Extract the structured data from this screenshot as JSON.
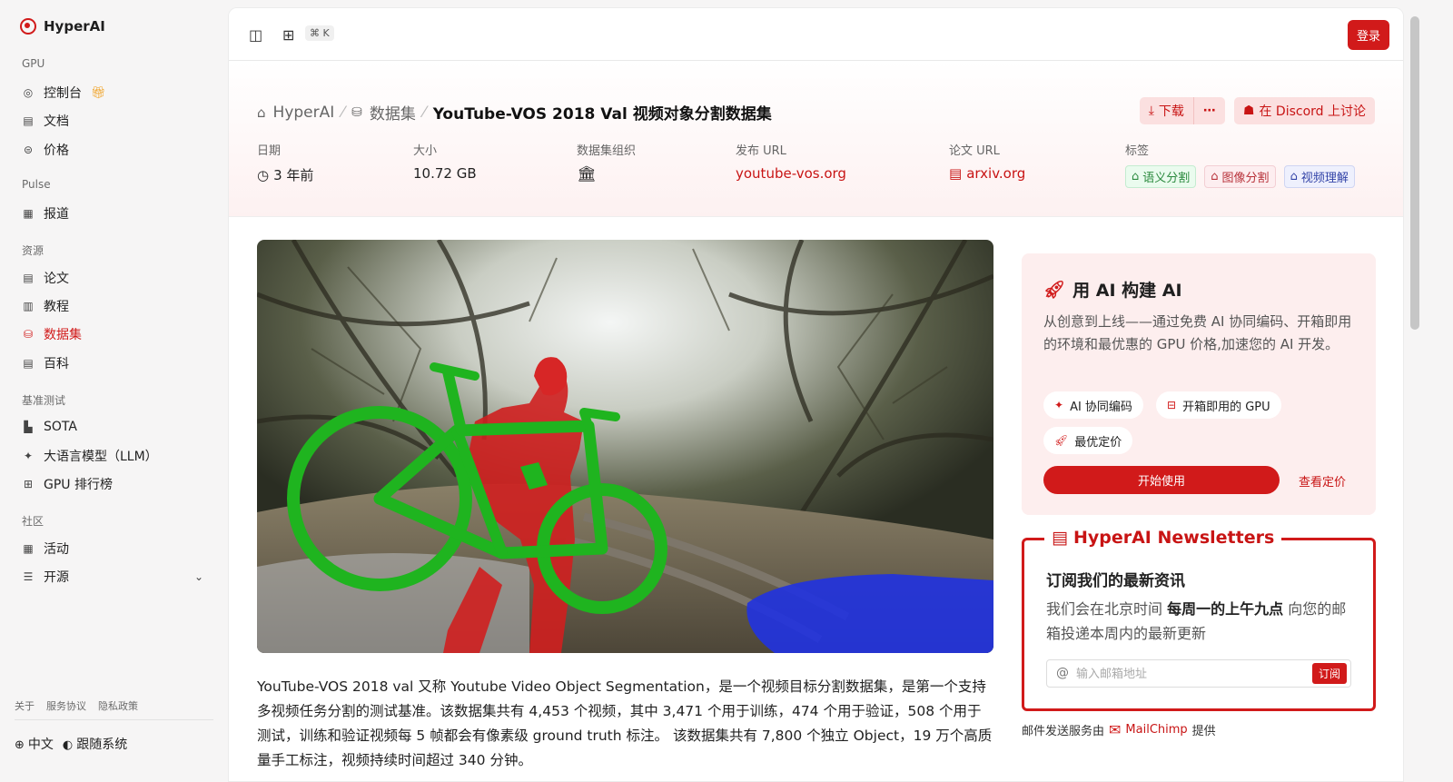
{
  "app": {
    "name": "HyperAI"
  },
  "sidebar": {
    "sections": [
      {
        "label": "GPU",
        "items": [
          {
            "label": "控制台",
            "icon": "dashboard-icon",
            "badge": "gift-icon"
          },
          {
            "label": "文档",
            "icon": "doc-icon"
          },
          {
            "label": "价格",
            "icon": "price-icon"
          }
        ]
      },
      {
        "label": "Pulse",
        "items": [
          {
            "label": "报道",
            "icon": "news-icon"
          }
        ]
      },
      {
        "label": "资源",
        "items": [
          {
            "label": "论文",
            "icon": "paper-icon"
          },
          {
            "label": "教程",
            "icon": "book-icon"
          },
          {
            "label": "数据集",
            "icon": "database-icon",
            "active": true
          },
          {
            "label": "百科",
            "icon": "wiki-icon"
          }
        ]
      },
      {
        "label": "基准测试",
        "items": [
          {
            "label": "SOTA",
            "icon": "chart-icon"
          },
          {
            "label": "大语言模型（LLM）",
            "icon": "sparkle-icon"
          },
          {
            "label": "GPU 排行榜",
            "icon": "chip-icon"
          }
        ]
      },
      {
        "label": "社区",
        "items": [
          {
            "label": "活动",
            "icon": "calendar-icon"
          },
          {
            "label": "开源",
            "icon": "menu-icon"
          }
        ]
      }
    ],
    "footer_links": [
      "关于",
      "服务协议",
      "隐私政策"
    ],
    "language": "中文",
    "theme": "跟随系统"
  },
  "topbar": {
    "shortcut": "⌘ K",
    "login_label": "登录"
  },
  "breadcrumb": {
    "home": "HyperAI",
    "section": "数据集",
    "current": "YouTube-VOS 2018 Val 视频对象分割数据集"
  },
  "actions": {
    "download": "下载",
    "more": "⋯",
    "discord": "在 Discord 上讨论"
  },
  "meta": {
    "date_label": "日期",
    "date_value": "3 年前",
    "size_label": "大小",
    "size_value": "10.72 GB",
    "org_label": "数据集组织",
    "url_label": "发布 URL",
    "url_value": "youtube-vos.org",
    "paper_label": "论文 URL",
    "paper_value": "arxiv.org",
    "tags_label": "标签",
    "tags": [
      "语义分割",
      "图像分割",
      "视频理解"
    ]
  },
  "description": "YouTube-VOS 2018 val 又称 Youtube Video Object Segmentation，是一个视频目标分割数据集，是第一个支持多视频任务分割的测试基准。该数据集共有 4,453 个视频，其中 3,471 个用于训练，474 个用于验证，508 个用于测试，训练和验证视频每 5 帧都会有像素级 ground truth 标注。 该数据集共有 7,800 个独立 Object，19 万个高质量手工标注，视频持续时间超过 340 分钟。",
  "ai_card": {
    "title": "用 AI 构建 AI",
    "text": "从创意到上线——通过免费 AI 协同编码、开箱即用的环境和最优惠的 GPU 价格,加速您的 AI 开发。",
    "features": [
      "AI 协同编码",
      "开箱即用的 GPU",
      "最优定价"
    ],
    "start_label": "开始使用",
    "pricing_label": "查看定价"
  },
  "newsletter": {
    "title": "HyperAI Newsletters",
    "heading": "订阅我们的最新资讯",
    "text_before": "我们会在北京时间",
    "text_bold": "每周一的上午九点",
    "text_after": "向您的邮箱投递本周内的最新更新",
    "placeholder": "输入邮箱地址",
    "subscribe_label": "订阅",
    "credit_before": "邮件发送服务由",
    "credit_brand": "MailChimp",
    "credit_after": "提供"
  },
  "colors": {
    "accent": "#d11a1a"
  }
}
